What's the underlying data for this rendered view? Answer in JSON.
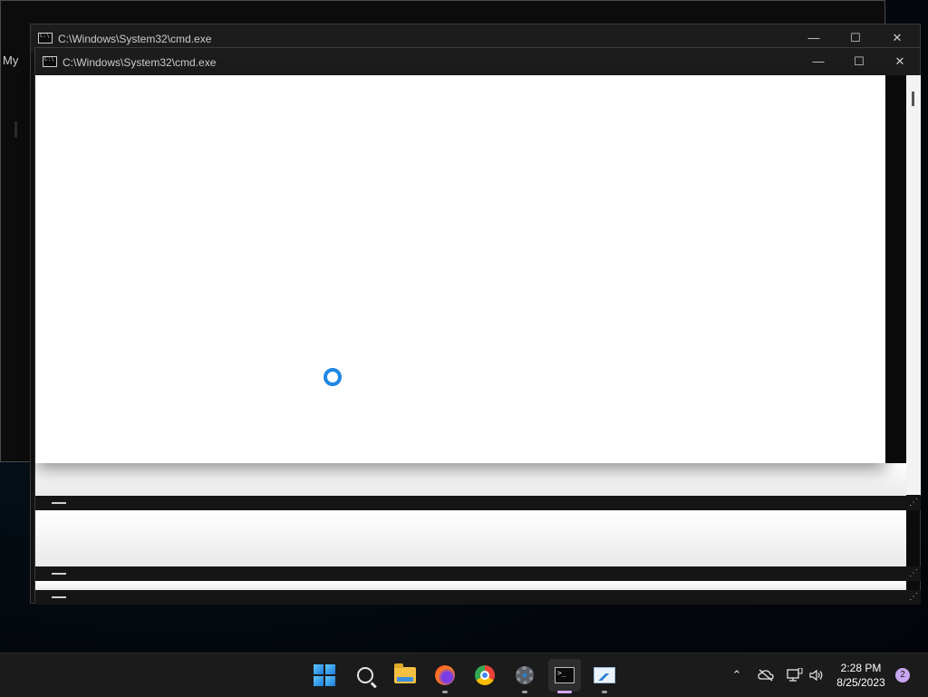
{
  "desktop": {
    "partial_label": "My"
  },
  "windows": [
    {
      "title": "C:\\Windows\\System32\\cmd.exe"
    },
    {
      "title": "C:\\Windows\\System32\\cmd.exe"
    }
  ],
  "title_controls": {
    "minimize": "—",
    "maximize": "☐",
    "close": "✕"
  },
  "taskbar": {
    "apps": [
      "start",
      "search",
      "file-explorer",
      "firefox",
      "chrome",
      "settings",
      "terminal",
      "resource-monitor"
    ],
    "tray": {
      "chevron": "⌃",
      "speaker": "🔊"
    },
    "clock": {
      "time": "2:28 PM",
      "date": "8/25/2023"
    },
    "notification_count": "2"
  },
  "colors": {
    "accent": "#1e88e5",
    "taskbar_bg": "#1b1b1b",
    "active_indicator": "#d6a6ff"
  }
}
